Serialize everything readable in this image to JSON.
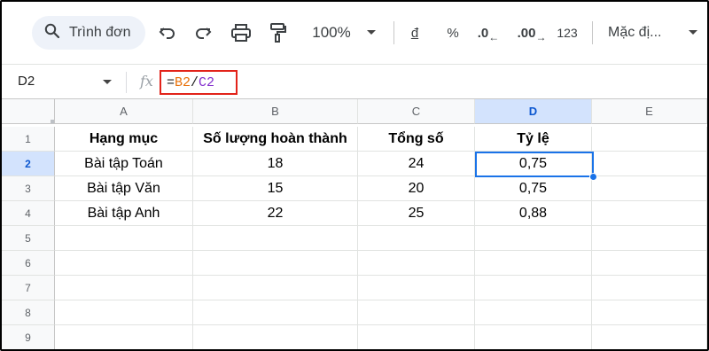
{
  "toolbar": {
    "search_label": "Trình đơn",
    "zoom": "100%",
    "currency": "đ",
    "percent": "%",
    "decrease_decimal": ".0",
    "increase_decimal": ".00",
    "number_format": "123",
    "font_name": "Mặc đị...",
    "icons": [
      "search-icon",
      "undo-icon",
      "redo-icon",
      "print-icon",
      "paint-format-icon",
      "chevron-down-icon"
    ]
  },
  "formula_bar": {
    "name_box": "D2",
    "fx": "fx",
    "formula_eq": "=",
    "formula_ref1": "B2",
    "formula_op": "/",
    "formula_ref2": "C2"
  },
  "sheet": {
    "columns": [
      "A",
      "B",
      "C",
      "D",
      "E"
    ],
    "rows": [
      "1",
      "2",
      "3",
      "4",
      "5",
      "6",
      "7",
      "8",
      "9"
    ],
    "header": [
      "Hạng mục",
      "Số lượng hoàn thành",
      "Tổng số",
      "Tỷ lệ",
      ""
    ],
    "data": [
      [
        "Bài tập Toán",
        "18",
        "24",
        "0,75",
        ""
      ],
      [
        "Bài tập Văn",
        "15",
        "20",
        "0,75",
        ""
      ],
      [
        "Bài tập Anh",
        "22",
        "25",
        "0,88",
        ""
      ]
    ],
    "active_cell": "D2",
    "colors": {
      "selection": "#1a73e8",
      "formula_highlight": "#e2231a",
      "ref_b": "#e8710a",
      "ref_c": "#8430ce"
    }
  }
}
